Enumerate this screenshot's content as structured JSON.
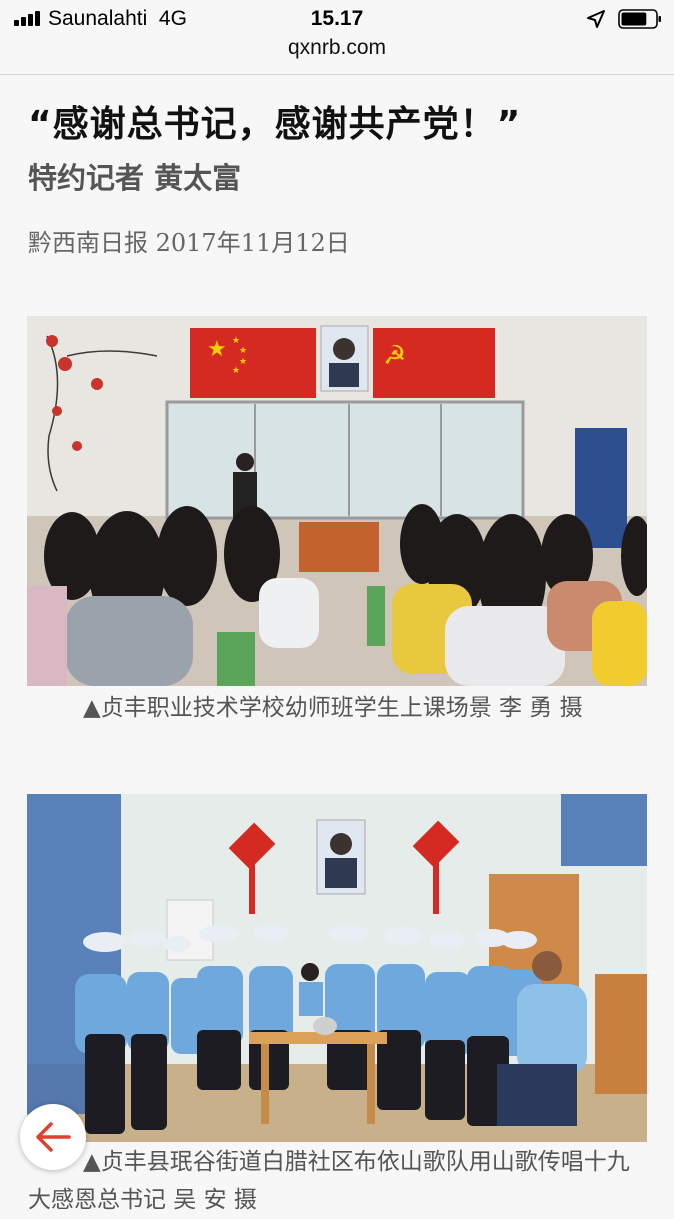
{
  "status_bar": {
    "carrier": "Saunalahti",
    "network": "4G",
    "time": "15.17",
    "signal_bars": 4,
    "battery_level": 0.75
  },
  "browser": {
    "url": "qxnrb.com"
  },
  "article": {
    "title": "“感谢总书记，感谢共产党！”",
    "byline": "特约记者 黄太富",
    "source": "黔西南日报 2017年11月12日",
    "photos": [
      {
        "caption": "▲贞丰职业技术学校幼师班学生上课场景 李 勇 摄"
      },
      {
        "caption": "▲贞丰县珉谷街道白腊社区布依山歌队用山歌传唱十九大感恩总书记 吴 安 摄"
      }
    ]
  },
  "icons": {
    "back": "back-arrow-icon",
    "location": "location-arrow-icon",
    "battery": "battery-icon",
    "signal": "signal-bars-icon"
  },
  "colors": {
    "back_arrow": "#e0402f",
    "flag_red": "#d42a22"
  }
}
